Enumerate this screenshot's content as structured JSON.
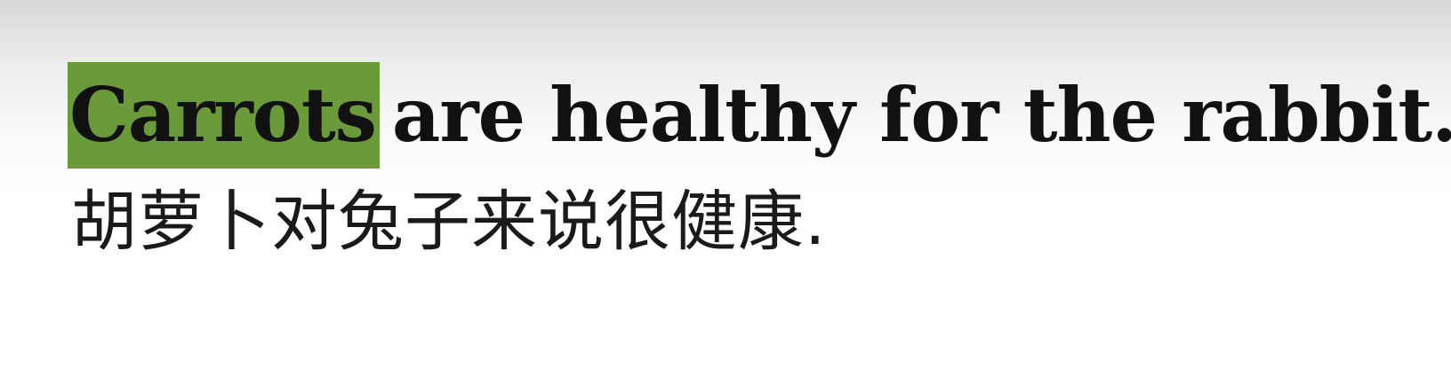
{
  "sentence": {
    "highlighted_word": "Carrots",
    "rest": "are healthy for the rabbit.",
    "highlight_color": "#6a9a3a"
  },
  "translation": {
    "text": "胡萝卜对兔子来说很健康."
  }
}
